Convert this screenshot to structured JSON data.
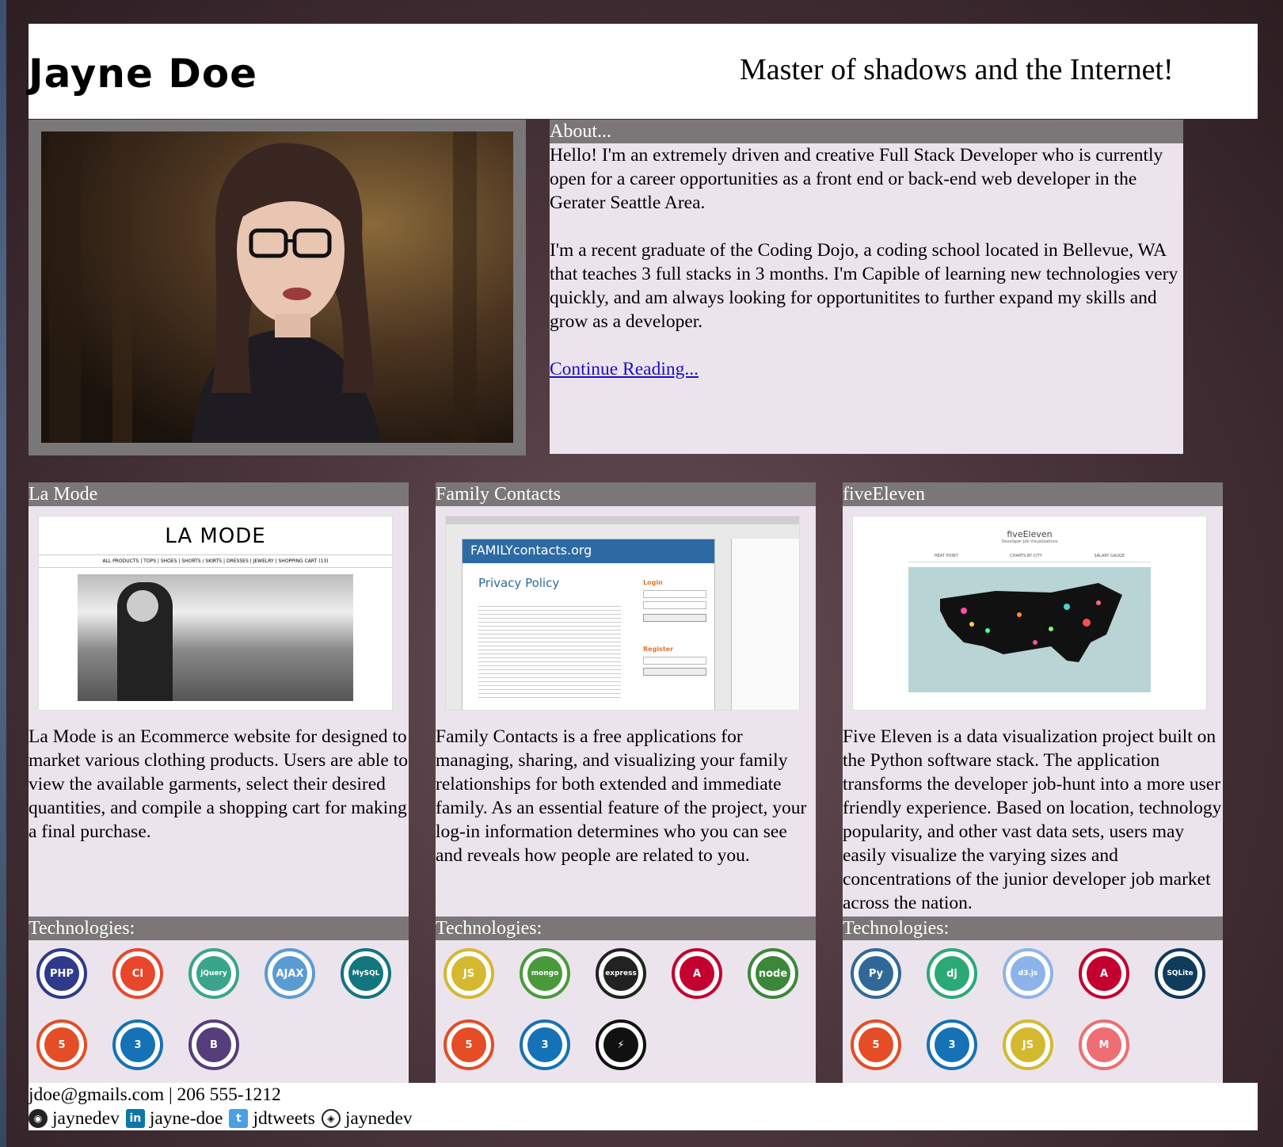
{
  "header": {
    "name": "Jayne Doe",
    "tagline": "Master of shadows and the Internet!"
  },
  "about": {
    "title": "About...",
    "paragraph1": "Hello! I'm an extremely driven and creative Full Stack Developer who is currently open for a career opportunities as a front end or back-end web developer in the Gerater Seattle Area.",
    "paragraph2": "I'm a recent graduate of the Coding Dojo, a coding school located in Bellevue, WA that teaches 3 full stacks in 3 months. I'm Capible of learning new technologies very quickly, and am always looking for opportunitites to further expand my skills and grow as a developer.",
    "link": "Continue Reading..."
  },
  "projects": [
    {
      "title": "La Mode",
      "shot_heading": "LA MODE",
      "shot_nav": "ALL PRODUCTS | TOPS | SHOES | SHORTS / SKIRTS | DRESSES | JEWELRY | SHOPPING CART (13)",
      "description": "La Mode is an Ecommerce website for designed to market various clothing products. Users are able to view the available garments, select their desired quantities, and compile a shopping cart for making a final purchase.",
      "tech_label": "Technologies:",
      "icons": [
        {
          "name": "php-icon",
          "label": "PHP",
          "color": "#2e3a8c"
        },
        {
          "name": "codeigniter-icon",
          "label": "CI",
          "color": "#e8472e"
        },
        {
          "name": "jquery-icon",
          "label": "jQuery",
          "color": "#3aa58c"
        },
        {
          "name": "ajax-icon",
          "label": "AJAX",
          "color": "#5a9bd4"
        },
        {
          "name": "mysql-icon",
          "label": "MySQL",
          "color": "#13757d"
        },
        {
          "name": "html5-icon",
          "label": "5",
          "color": "#e44d26"
        },
        {
          "name": "css3-icon",
          "label": "3",
          "color": "#1572b6"
        },
        {
          "name": "bootstrap-icon",
          "label": "B",
          "color": "#563d7c"
        }
      ]
    },
    {
      "title": "Family Contacts",
      "shot_heading": "FAMILYcontacts.org",
      "shot_sub": "Privacy Policy",
      "shot_login": "Login",
      "shot_register": "Register",
      "description": "Family Contacts is a free applications for managing, sharing, and visualizing your family relationships for both extended and immediate family. As an essential feature of the project, your log-in information determines who you can see and reveals how people are related to you.",
      "tech_label": "Technologies:",
      "icons": [
        {
          "name": "javascript-icon",
          "label": "JS",
          "color": "#d4b830"
        },
        {
          "name": "mongodb-icon",
          "label": "mongo",
          "color": "#4a9a3c"
        },
        {
          "name": "express-icon",
          "label": "express",
          "color": "#222222"
        },
        {
          "name": "angular-icon",
          "label": "A",
          "color": "#c3002f"
        },
        {
          "name": "nodejs-icon",
          "label": "node",
          "color": "#3c873a"
        },
        {
          "name": "html5-icon",
          "label": "5",
          "color": "#e44d26"
        },
        {
          "name": "css3-icon",
          "label": "3",
          "color": "#1572b6"
        },
        {
          "name": "socketio-icon",
          "label": "⚡",
          "color": "#111111"
        }
      ]
    },
    {
      "title": "fiveEleven",
      "shot_heading": "fiveEleven",
      "shot_sub": "Developer Job Visualizations",
      "shot_tabs": [
        "HEAT POINT",
        "CHARTS BY CITY",
        "SALARY GAUGE"
      ],
      "description": "Five Eleven is a data visualization project built on the Python software stack. The application transforms the developer job-hunt into a more user friendly experience. Based on location, technology popularity, and other vast data sets, users may easily visualize the varying sizes and concentrations of the junior developer job market across the nation.",
      "tech_label": "Technologies:",
      "icons": [
        {
          "name": "python-icon",
          "label": "Py",
          "color": "#306998"
        },
        {
          "name": "django-icon",
          "label": "dj",
          "color": "#2ba977"
        },
        {
          "name": "d3js-icon",
          "label": "d3.js",
          "color": "#8cb4e8"
        },
        {
          "name": "angular-icon",
          "label": "A",
          "color": "#c3002f"
        },
        {
          "name": "sqlite-icon",
          "label": "SQLite",
          "color": "#0f3b5c"
        },
        {
          "name": "html5-icon",
          "label": "5",
          "color": "#e44d26"
        },
        {
          "name": "css3-icon",
          "label": "3",
          "color": "#1572b6"
        },
        {
          "name": "javascript-icon",
          "label": "JS",
          "color": "#d4b830"
        },
        {
          "name": "materialize-icon",
          "label": "M",
          "color": "#ee6e73"
        }
      ]
    }
  ],
  "footer": {
    "contact": "jdoe@gmails.com | 206 555-1212",
    "github": "jaynedev",
    "linkedin": "jayne-doe",
    "twitter": "jdtweets",
    "codepen": "jaynedev"
  }
}
